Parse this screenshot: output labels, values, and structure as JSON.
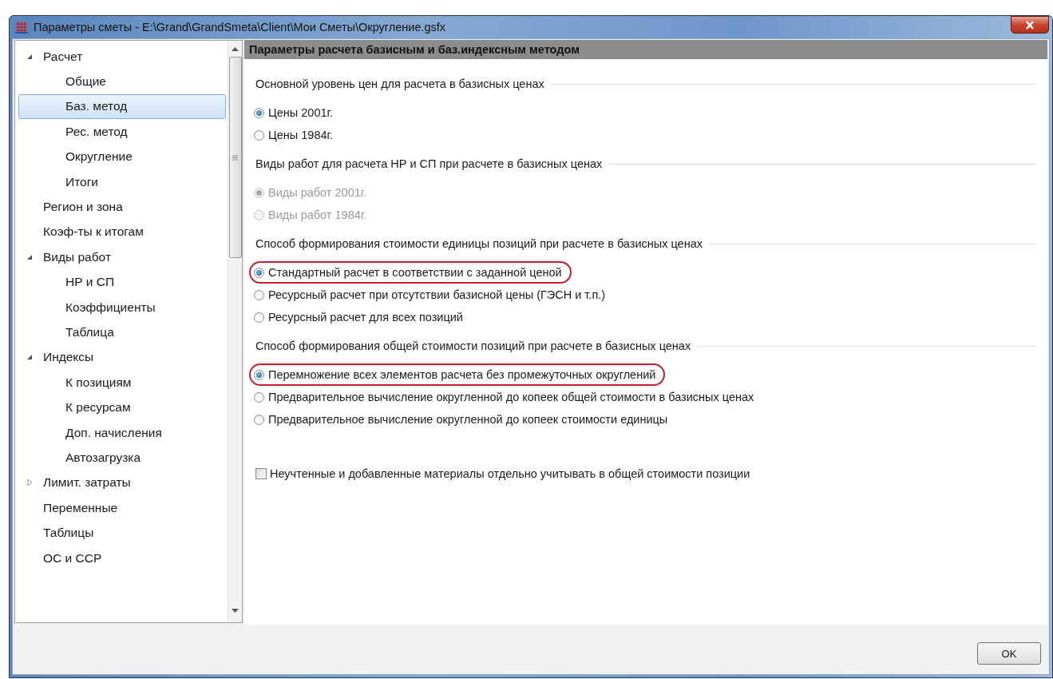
{
  "window": {
    "title": "Параметры сметы - E:\\Grand\\GrandSmeta\\Client\\Мои Сметы\\Округление.gsfx"
  },
  "sidebar": {
    "items": [
      {
        "label": "Расчет",
        "selected": false,
        "expanded": true,
        "children": [
          {
            "label": "Общие",
            "selected": false
          },
          {
            "label": "Баз. метод",
            "selected": true
          },
          {
            "label": "Рес. метод",
            "selected": false
          },
          {
            "label": "Округление",
            "selected": false
          },
          {
            "label": "Итоги",
            "selected": false
          }
        ]
      },
      {
        "label": "Регион и зона",
        "selected": false
      },
      {
        "label": "Коэф-ты к итогам",
        "selected": false
      },
      {
        "label": "Виды работ",
        "selected": false,
        "expanded": true,
        "children": [
          {
            "label": "НР и СП",
            "selected": false
          },
          {
            "label": "Коэффициенты",
            "selected": false
          },
          {
            "label": "Таблица",
            "selected": false
          }
        ]
      },
      {
        "label": "Индексы",
        "selected": false,
        "expanded": true,
        "children": [
          {
            "label": "К позициям",
            "selected": false
          },
          {
            "label": "К ресурсам",
            "selected": false
          },
          {
            "label": "Доп. начисления",
            "selected": false
          },
          {
            "label": "Автозагрузка",
            "selected": false
          }
        ]
      },
      {
        "label": "Лимит. затраты",
        "selected": false,
        "expanded": false
      },
      {
        "label": "Переменные",
        "selected": false
      },
      {
        "label": "Таблицы",
        "selected": false
      },
      {
        "label": "ОС и ССР",
        "selected": false
      }
    ]
  },
  "panel": {
    "title": "Параметры расчета базисным и баз.индексным методом",
    "sections": [
      {
        "heading": "Основной уровень цен для расчета в базисных ценах",
        "options": [
          {
            "label": "Цены 2001г.",
            "selected": true,
            "disabled": false,
            "highlighted": false
          },
          {
            "label": "Цены 1984г.",
            "selected": false,
            "disabled": false,
            "highlighted": false
          }
        ]
      },
      {
        "heading": "Виды работ для расчета НР и СП при расчете в базисных ценах",
        "options": [
          {
            "label": "Виды работ 2001г.",
            "selected": true,
            "disabled": true,
            "highlighted": false
          },
          {
            "label": "Виды работ 1984г.",
            "selected": false,
            "disabled": true,
            "highlighted": false
          }
        ]
      },
      {
        "heading": "Способ формирования стоимости единицы позиций при расчете в базисных ценах",
        "options": [
          {
            "label": "Стандартный расчет в соответствии с заданной ценой",
            "selected": true,
            "disabled": false,
            "highlighted": true
          },
          {
            "label": "Ресурсный расчет при отсутствии базисной цены (ГЭСН и т.п.)",
            "selected": false,
            "disabled": false,
            "highlighted": false
          },
          {
            "label": "Ресурсный расчет для всех позиций",
            "selected": false,
            "disabled": false,
            "highlighted": false
          }
        ]
      },
      {
        "heading": "Способ формирования общей стоимости позиций при расчете в базисных ценах",
        "options": [
          {
            "label": "Перемножение всех элементов расчета без промежуточных округлений",
            "selected": true,
            "disabled": false,
            "highlighted": true
          },
          {
            "label": "Предварительное вычисление округленной до копеек общей стоимости в базисных ценах",
            "selected": false,
            "disabled": false,
            "highlighted": false
          },
          {
            "label": "Предварительное вычисление округленной до копеек стоимости единицы",
            "selected": false,
            "disabled": false,
            "highlighted": false
          }
        ]
      }
    ],
    "checkbox": {
      "label": "Неучтенные и добавленные материалы отдельно учитывать в общей стоимости позиции",
      "checked": false
    }
  },
  "buttons": [
    {
      "label": "OK"
    }
  ]
}
